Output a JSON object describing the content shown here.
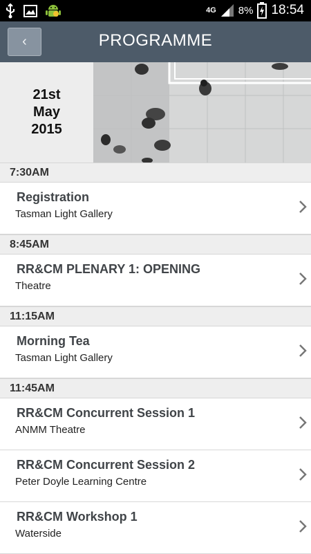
{
  "status_bar": {
    "icons": [
      "usb-icon",
      "image-icon",
      "android-icon",
      "signal-icon",
      "battery-charging-icon"
    ],
    "network": "4G",
    "battery": "8%",
    "time": "18:54"
  },
  "header": {
    "back_label": "‹",
    "title": "PROGRAMME"
  },
  "banner": {
    "day": "21st",
    "month": "May",
    "year": "2015"
  },
  "programme": [
    {
      "time": "7:30AM",
      "sessions": [
        {
          "title": "Registration",
          "location": "Tasman Light Gallery"
        }
      ]
    },
    {
      "time": "8:45AM",
      "sessions": [
        {
          "title": "RR&CM PLENARY 1: OPENING",
          "location": "Theatre"
        }
      ]
    },
    {
      "time": "11:15AM",
      "sessions": [
        {
          "title": "Morning Tea",
          "location": "Tasman Light Gallery"
        }
      ]
    },
    {
      "time": "11:45AM",
      "sessions": [
        {
          "title": "RR&CM Concurrent Session 1",
          "location": "ANMM Theatre"
        },
        {
          "title": "RR&CM Concurrent Session 2",
          "location": "Peter Doyle Learning Centre"
        },
        {
          "title": "RR&CM Workshop 1",
          "location": "Waterside"
        }
      ]
    }
  ]
}
